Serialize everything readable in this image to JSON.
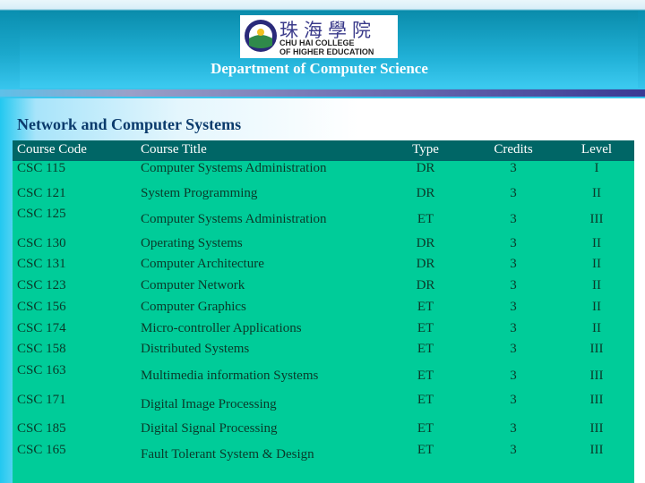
{
  "header": {
    "logo_cn": "珠海學院",
    "logo_en1": "CHU HAI COLLEGE",
    "logo_en2": "OF HIGHER EDUCATION",
    "department": "Department of Computer Science"
  },
  "section_title": "Network and Computer Systems",
  "columns": [
    "Course Code",
    "Course Title",
    "Type",
    "Credits",
    "Level"
  ],
  "rows": [
    [
      "CSC 115",
      "Computer Systems Administration",
      "DR",
      "3",
      "I"
    ],
    [
      "CSC 121",
      "System Programming",
      "DR",
      "3",
      "II"
    ],
    [
      "CSC 125",
      "Computer Systems Administration",
      "ET",
      "3",
      "III"
    ],
    [
      "CSC 130",
      "Operating Systems",
      "DR",
      "3",
      "II"
    ],
    [
      "CSC 131",
      "Computer Architecture",
      "DR",
      "3",
      "II"
    ],
    [
      "CSC 123",
      "Computer Network",
      "DR",
      "3",
      "II"
    ],
    [
      "CSC 156",
      "Computer Graphics",
      "ET",
      "3",
      "II"
    ],
    [
      "CSC 174",
      "Micro-controller Applications",
      "ET",
      "3",
      "II"
    ],
    [
      "CSC 158",
      "Distributed Systems",
      "ET",
      "3",
      "III"
    ],
    [
      "CSC 163",
      "Multimedia information Systems",
      "ET",
      "3",
      "III"
    ],
    [
      "CSC 171",
      "Digital Image Processing",
      "ET",
      "3",
      "III"
    ],
    [
      "CSC 185",
      "Digital Signal Processing",
      "ET",
      "3",
      "III"
    ],
    [
      "CSC 165",
      "Fault Tolerant System & Design",
      "ET",
      "3",
      "III"
    ]
  ]
}
